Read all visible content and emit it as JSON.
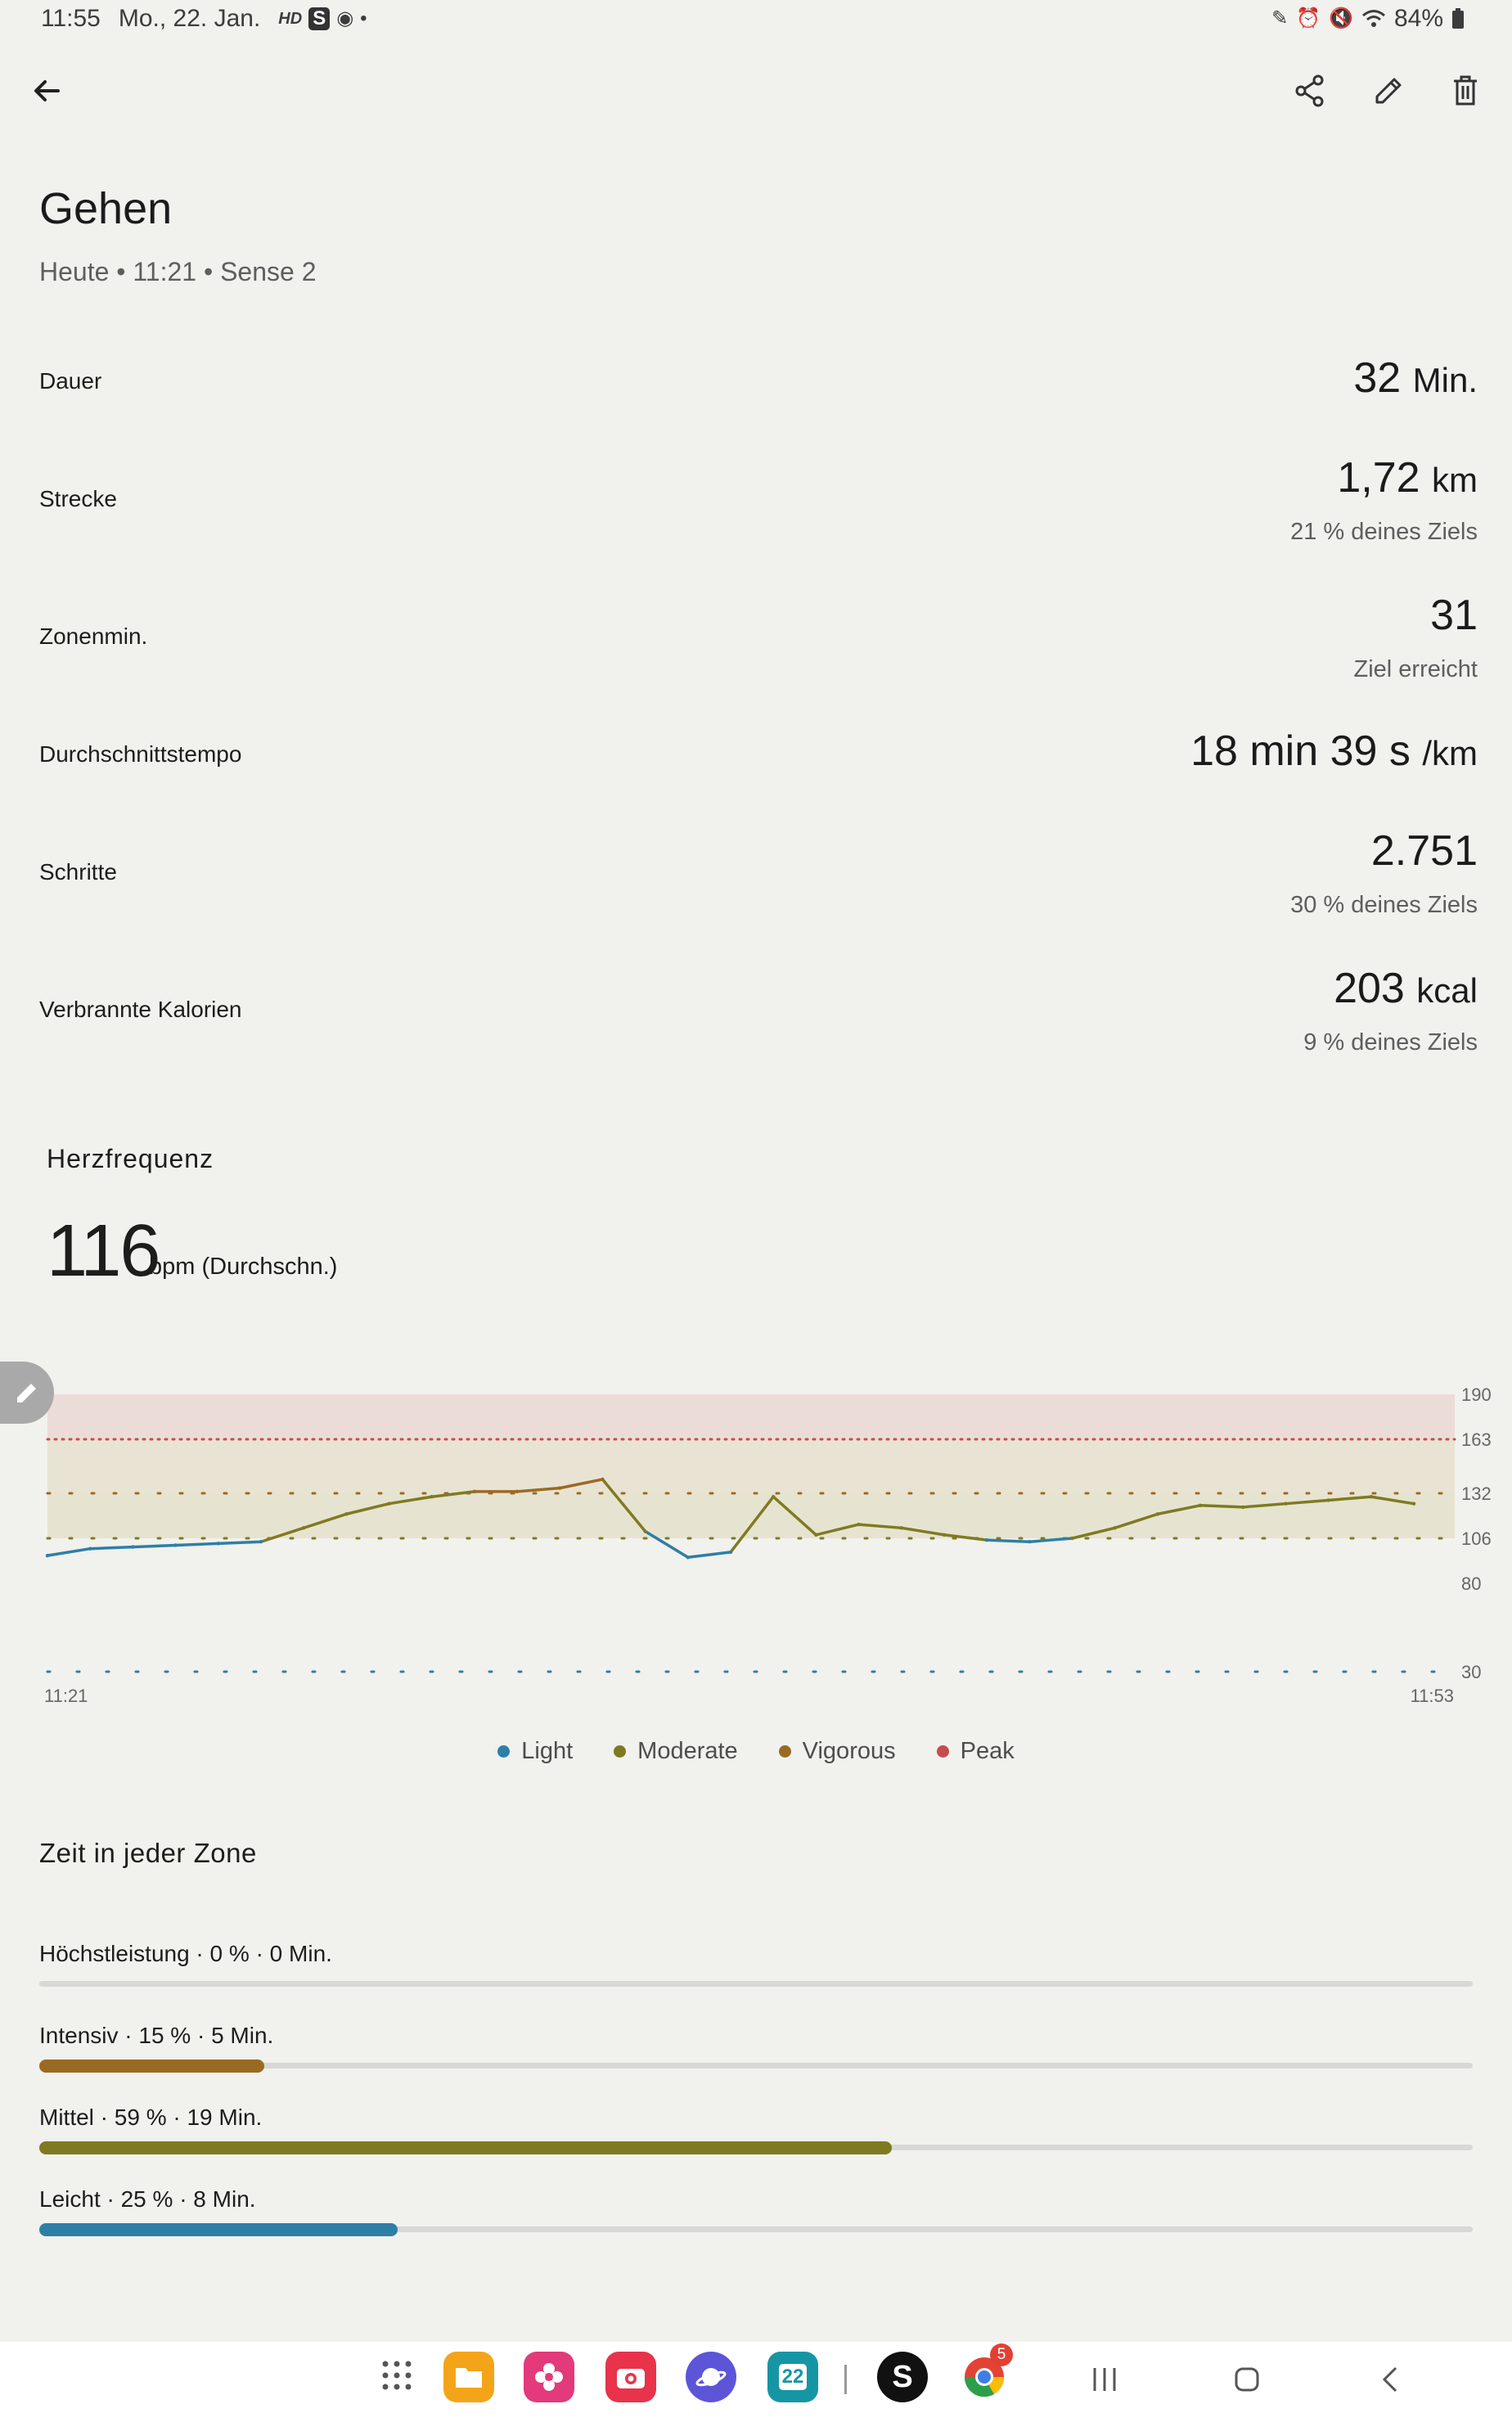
{
  "status_bar": {
    "time": "11:55",
    "date": "Mo., 22. Jan.",
    "battery": "84%",
    "icons": [
      "hd-icon",
      "s-app-icon",
      "chrome-icon",
      "dot-icon",
      "pen-icon",
      "alarm-icon",
      "mute-icon",
      "wifi-icon",
      "battery-icon"
    ],
    "hd_label": "HD",
    "s_label": "S"
  },
  "toolbar": {
    "back": "arrow-left-icon",
    "actions": [
      "share-icon",
      "edit-icon",
      "delete-icon"
    ]
  },
  "activity": {
    "title": "Gehen",
    "subtitle": "Heute • 11:21 • Sense 2"
  },
  "stats": [
    {
      "label": "Dauer",
      "value": "32",
      "unit": "Min.",
      "sub": ""
    },
    {
      "label": "Strecke",
      "value": "1,72",
      "unit": "km",
      "sub": "21 % deines Ziels"
    },
    {
      "label": "Zonenmin.",
      "value": "31",
      "unit": "",
      "sub": "Ziel erreicht"
    },
    {
      "label": "Durchschnittstempo",
      "value": "18 min 39 s",
      "unit": "/km",
      "sub": ""
    },
    {
      "label": "Schritte",
      "value": "2.751",
      "unit": "",
      "sub": "30 % deines Ziels"
    },
    {
      "label": "Verbrannte Kalorien",
      "value": "203",
      "unit": "kcal",
      "sub": "9 % deines Ziels"
    }
  ],
  "heart_rate": {
    "title": "Herzfrequenz",
    "average": "116",
    "unit": "bpm (Durchschn.)"
  },
  "chart_data": {
    "type": "line",
    "title": "",
    "xlabel": "",
    "ylabel": "",
    "x_tick_labels": [
      "11:21",
      "11:53"
    ],
    "y_tick_labels": [
      "190",
      "163",
      "132",
      "106",
      "80",
      "30"
    ],
    "y_ticks": [
      190,
      163,
      132,
      106,
      80,
      30
    ],
    "ylim": [
      30,
      190
    ],
    "zone_thresholds": {
      "light": 106,
      "moderate": 132,
      "vigorous": 163
    },
    "legend": [
      "Light",
      "Moderate",
      "Vigorous",
      "Peak"
    ],
    "legend_colors": [
      "#2e7fa6",
      "#7f7a22",
      "#9a6a23",
      "#c74c4c"
    ],
    "x_minutes": [
      0,
      1,
      2,
      3,
      4,
      5,
      6,
      7,
      8,
      9,
      10,
      11,
      12,
      13,
      14,
      15,
      16,
      17,
      18,
      19,
      20,
      21,
      22,
      23,
      24,
      25,
      26,
      27,
      28,
      29,
      30,
      31,
      32
    ],
    "series": [
      {
        "values": [
          96,
          100,
          101,
          102,
          103,
          104,
          112,
          120,
          126,
          130,
          133,
          133,
          135,
          140,
          110,
          95,
          98,
          130,
          108,
          114,
          112,
          108,
          105,
          104,
          106,
          112,
          120,
          125,
          124,
          126,
          128,
          130,
          126
        ]
      }
    ]
  },
  "zones": {
    "title": "Zeit in jeder Zone",
    "items": [
      {
        "label": "Höchstleistung · 0 % · 0 Min.",
        "fraction": 0.0,
        "color": "#c74c4c"
      },
      {
        "label": "Intensiv · 15 % · 5 Min.",
        "fraction": 0.157,
        "color": "#9a6a23"
      },
      {
        "label": "Mittel · 59 % · 19 Min.",
        "fraction": 0.595,
        "color": "#7f7a22"
      },
      {
        "label": "Leicht · 25 % · 8 Min.",
        "fraction": 0.25,
        "color": "#2e7fa6"
      }
    ]
  },
  "navbar": {
    "apps": [
      {
        "name": "app-drawer-icon",
        "color": "#ffffff"
      },
      {
        "name": "files-app-icon",
        "color": "#f4a418"
      },
      {
        "name": "flower-app-icon",
        "color": "#e23a7a"
      },
      {
        "name": "camera-app-icon",
        "color": "#e8334a"
      },
      {
        "name": "internet-app-icon",
        "color": "#5d55d8"
      },
      {
        "name": "calendar-app-icon",
        "color": "#1696a4"
      },
      {
        "name": "s-app-icon",
        "color": "#111111"
      },
      {
        "name": "chrome-app-icon",
        "color": "#ffffff"
      }
    ],
    "calendar_label": "22",
    "s_label": "S",
    "chrome_badge": "5"
  }
}
